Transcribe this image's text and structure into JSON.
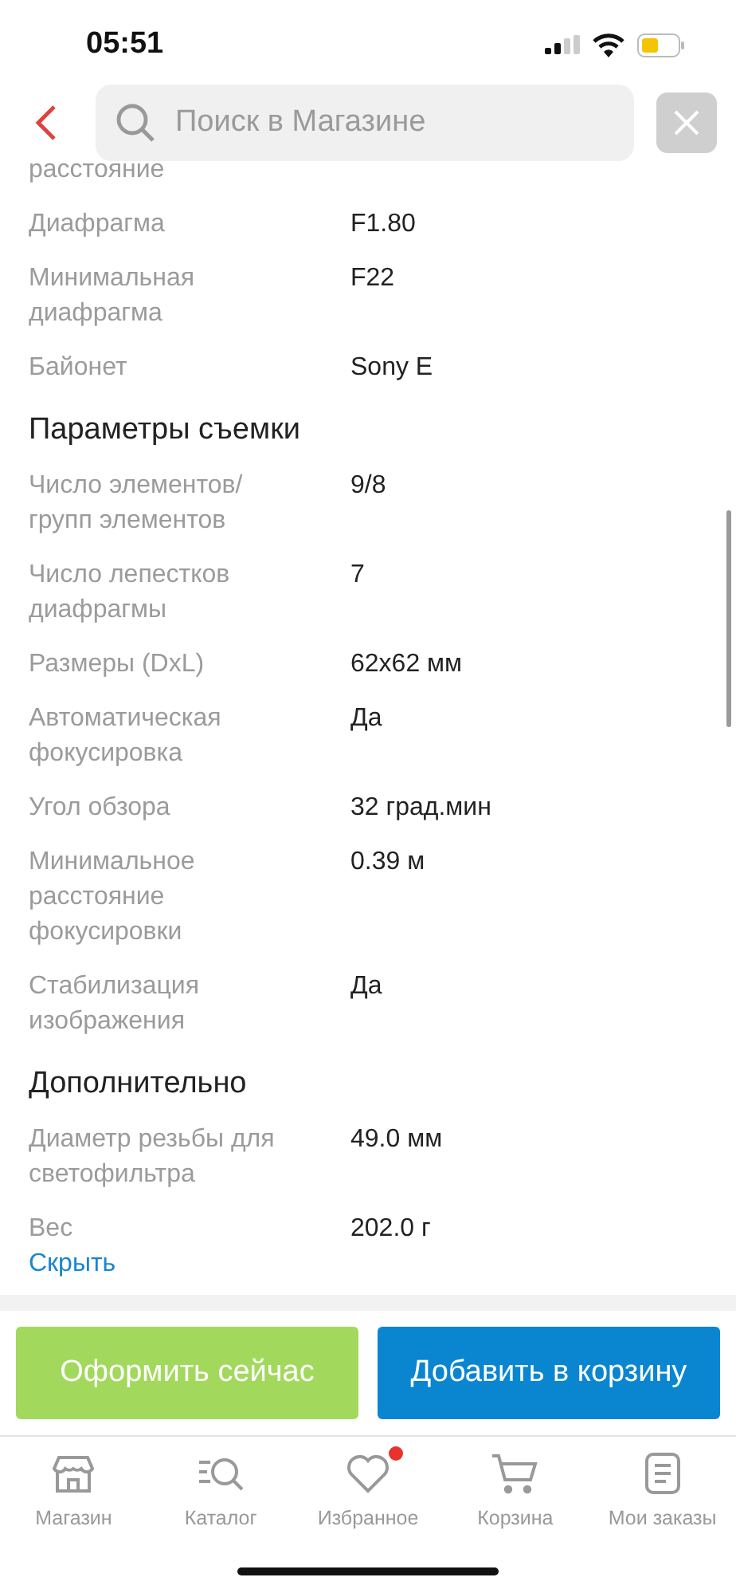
{
  "status_bar": {
    "time": "05:51"
  },
  "search": {
    "placeholder": "Поиск в Магазине"
  },
  "specs": [
    {
      "kind": "row",
      "label": "расстояние"
    },
    {
      "kind": "row",
      "label": "Диафрагма",
      "value": "F1.80"
    },
    {
      "kind": "row",
      "label": "Минимальная диафрагма",
      "value": "F22"
    },
    {
      "kind": "row",
      "label": "Байонет",
      "value": "Sony E"
    },
    {
      "kind": "heading",
      "label": "Параметры съемки"
    },
    {
      "kind": "row",
      "label": "Число элементов/ групп элементов",
      "value": "9/8"
    },
    {
      "kind": "row",
      "label": "Число лепестков диафрагмы",
      "value": "7"
    },
    {
      "kind": "row",
      "label": "Размеры (DxL)",
      "value": "62x62 мм"
    },
    {
      "kind": "row",
      "label": "Автоматическая фокусировка",
      "value": "Да"
    },
    {
      "kind": "row",
      "label": "Угол обзора",
      "value": "32 град.мин"
    },
    {
      "kind": "row",
      "label": "Минимальное расстояние фокусировки",
      "value": "0.39 м"
    },
    {
      "kind": "row",
      "label": "Стабилизация изображения",
      "value": "Да"
    },
    {
      "kind": "heading",
      "label": "Дополнительно"
    },
    {
      "kind": "row",
      "label": "Диаметр резьбы для светофильтра",
      "value": "49.0 мм"
    },
    {
      "kind": "row",
      "label": "Вес",
      "value": "202.0 г"
    }
  ],
  "toggle_link": "Скрыть",
  "buttons": [
    {
      "kind": "checkout",
      "label": "Оформить сейчас"
    },
    {
      "kind": "cart",
      "label": "Добавить в корзину"
    }
  ],
  "tabs": [
    {
      "kind": "store",
      "label": "Магазин",
      "selected": false,
      "dot": false
    },
    {
      "kind": "catalog",
      "label": "Каталог",
      "selected": false,
      "dot": false
    },
    {
      "kind": "favorites",
      "label": "Избранное",
      "selected": false,
      "dot": true
    },
    {
      "kind": "cart",
      "label": "Корзина",
      "selected": false,
      "dot": false
    },
    {
      "kind": "orders",
      "label": "Мои заказы",
      "selected": false,
      "dot": false
    }
  ]
}
